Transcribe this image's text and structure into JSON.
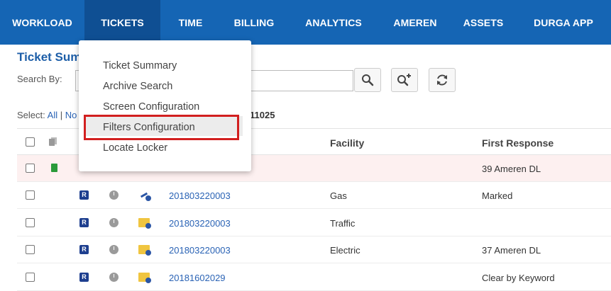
{
  "nav": {
    "items": [
      {
        "label": "WORKLOAD",
        "active": false
      },
      {
        "label": "TICKETS",
        "active": true
      },
      {
        "label": "TIME",
        "active": false
      },
      {
        "label": "BILLING",
        "active": false
      },
      {
        "label": "ANALYTICS",
        "active": false
      },
      {
        "label": "AMEREN",
        "active": false
      },
      {
        "label": "ASSETS",
        "active": false
      },
      {
        "label": "DURGA APP",
        "active": false
      }
    ]
  },
  "page": {
    "title": "Ticket Sum",
    "search_label": "Search By:",
    "select_prefix": "Select:",
    "select_all": "All",
    "select_sep": "|",
    "select_none": "No",
    "ticket_header_partial": "11025"
  },
  "table": {
    "headers": {
      "facility": "Facility",
      "first_response": "First Response"
    },
    "rows": [
      {
        "ticket": "",
        "facility": "",
        "first_response": "39 Ameren DL"
      },
      {
        "ticket": "201803220003",
        "facility": "Gas",
        "first_response": "Marked"
      },
      {
        "ticket": "201803220003",
        "facility": "Traffic",
        "first_response": ""
      },
      {
        "ticket": "201803220003",
        "facility": "Electric",
        "first_response": "37 Ameren DL"
      },
      {
        "ticket": "20181602029",
        "facility": "",
        "first_response": "Clear by Keyword"
      }
    ]
  },
  "menu": {
    "items": [
      {
        "label": "Ticket Summary"
      },
      {
        "label": "Archive Search"
      },
      {
        "label": "Screen Configuration"
      },
      {
        "label": "Filters Configuration"
      },
      {
        "label": "Locate Locker"
      }
    ]
  },
  "colors": {
    "nav_bg": "#1565b4",
    "nav_active": "#0f4f93",
    "link": "#2a63b5",
    "highlight_box": "#d21f1f"
  }
}
